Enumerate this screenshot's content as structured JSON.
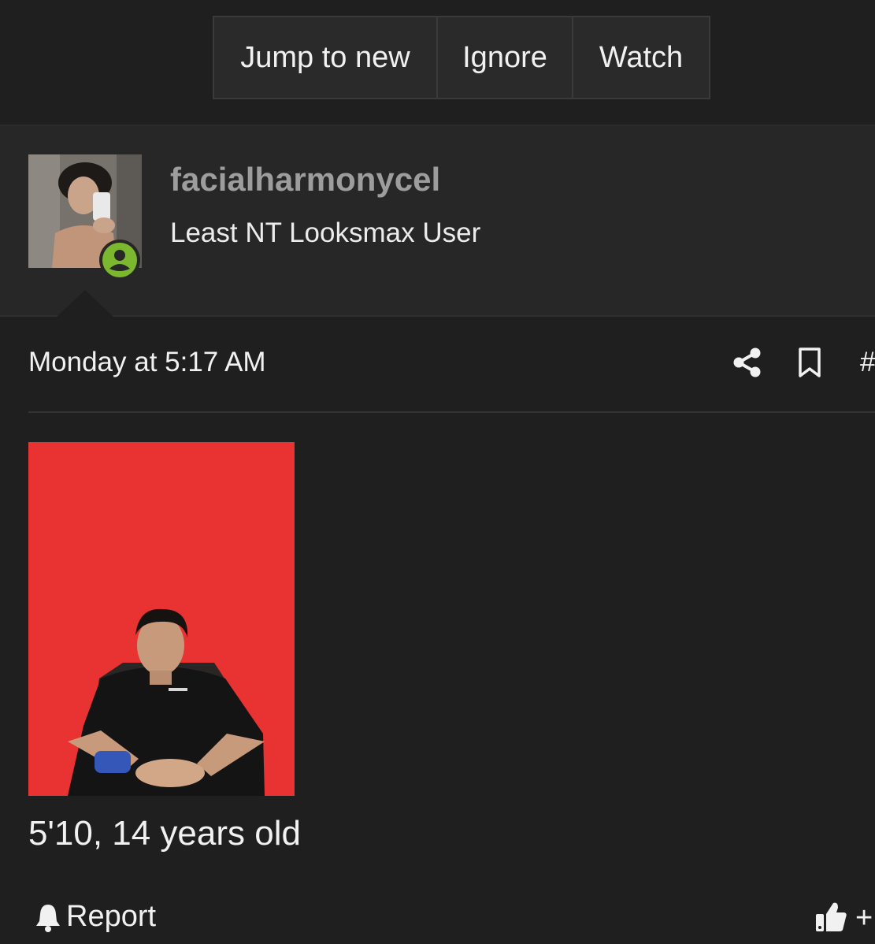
{
  "toolbar": {
    "jump_label": "Jump to new",
    "ignore_label": "Ignore",
    "watch_label": "Watch"
  },
  "user": {
    "name": "facialharmonycel",
    "title": "Least NT Looksmax User",
    "status_color": "#7cb82f"
  },
  "post": {
    "date": "Monday at 5:17 AM",
    "hash_label": "#",
    "image_background": "#e93232",
    "text": "5'10, 14 years old"
  },
  "footer": {
    "report_label": "Report",
    "like_plus": "+"
  },
  "icons": {
    "share": "share-icon",
    "bookmark": "bookmark-icon",
    "bell": "bell-icon",
    "like": "thumbs-up-icon",
    "online": "user-online-icon"
  }
}
